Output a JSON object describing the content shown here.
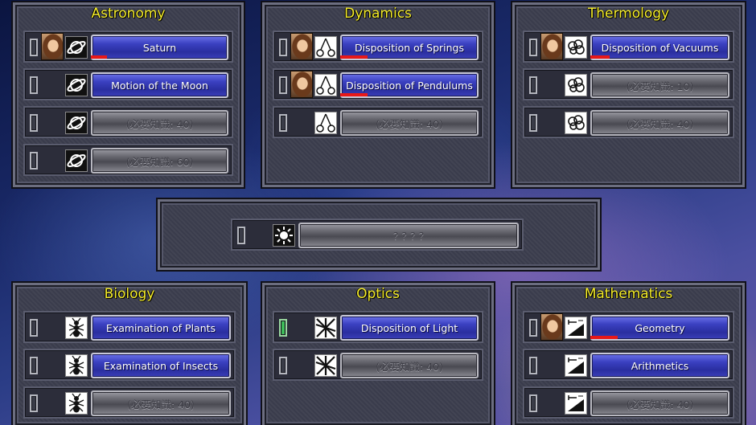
{
  "panels": [
    {
      "title": "Astronomy",
      "rows": [
        {
          "portrait": true,
          "icon": "planet",
          "label": "Saturn",
          "state": "on",
          "progress": 0.12
        },
        {
          "portrait": false,
          "icon": "planet",
          "label": "Motion of the Moon",
          "state": "on"
        },
        {
          "portrait": false,
          "icon": "planet",
          "label": "(必要知識: 40)",
          "state": "off"
        },
        {
          "portrait": false,
          "icon": "planet",
          "label": "(必要知識: 60)",
          "state": "off"
        }
      ]
    },
    {
      "title": "Dynamics",
      "rows": [
        {
          "portrait": true,
          "icon": "pendulum",
          "label": "Disposition of Springs",
          "state": "on",
          "progress": 0.2
        },
        {
          "portrait": true,
          "icon": "pendulum",
          "label": "Disposition of Pendulums",
          "state": "on",
          "progress": 0.2
        },
        {
          "portrait": false,
          "icon": "pendulum",
          "label": "(必要知識: 40)",
          "state": "off"
        }
      ]
    },
    {
      "title": "Thermology",
      "rows": [
        {
          "portrait": true,
          "icon": "cloud",
          "label": "Disposition of Vacuums",
          "state": "on",
          "progress": 0.14
        },
        {
          "portrait": false,
          "icon": "cloud",
          "label": "(必要知識: 10)",
          "state": "off"
        },
        {
          "portrait": false,
          "icon": "cloud",
          "label": "(必要知識: 40)",
          "state": "off"
        }
      ]
    },
    {
      "title": "",
      "rows": [
        {
          "portrait": false,
          "icon": "sun",
          "label": "? ? ? ?",
          "state": "off"
        }
      ]
    },
    {
      "title": "Biology",
      "rows": [
        {
          "portrait": false,
          "icon": "insect",
          "label": "Examination of Plants",
          "state": "on"
        },
        {
          "portrait": false,
          "icon": "insect",
          "label": "Examination of Insects",
          "state": "on"
        },
        {
          "portrait": false,
          "icon": "insect",
          "label": "(必要知識: 40)",
          "state": "off"
        }
      ]
    },
    {
      "title": "Optics",
      "rows": [
        {
          "portrait": false,
          "icon": "light",
          "label": "Disposition of Light",
          "state": "on",
          "slot": "green"
        },
        {
          "portrait": false,
          "icon": "light",
          "label": "(必要知識: 40)",
          "state": "off"
        }
      ]
    },
    {
      "title": "Mathematics",
      "rows": [
        {
          "portrait": true,
          "icon": "triangle",
          "label": "Geometry",
          "state": "on",
          "progress": 0.2
        },
        {
          "portrait": false,
          "icon": "triangle",
          "label": "Arithmetics",
          "state": "on"
        },
        {
          "portrait": false,
          "icon": "triangle",
          "label": "(必要知識: 40)",
          "state": "off"
        }
      ]
    }
  ],
  "colors": {
    "title": "#f6ee2a",
    "progress": "#e81818",
    "button_on": "#2a2ea0",
    "button_off": "#6a6a72"
  }
}
